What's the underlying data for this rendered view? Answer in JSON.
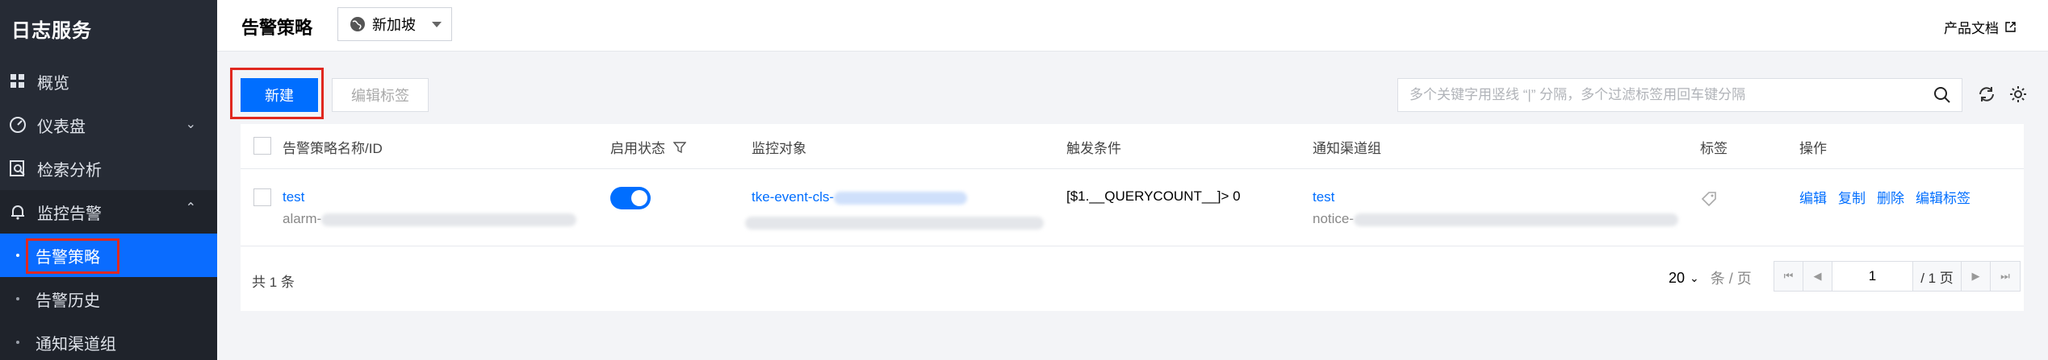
{
  "sidebar": {
    "brand": "日志服务",
    "items": [
      {
        "label": "概览",
        "icon": "grid-icon"
      },
      {
        "label": "仪表盘",
        "icon": "dashboard-icon"
      },
      {
        "label": "检索分析",
        "icon": "search-doc-icon"
      },
      {
        "label": "监控告警",
        "icon": "bell-icon"
      }
    ],
    "subitems": [
      {
        "label": "告警策略",
        "active": true
      },
      {
        "label": "告警历史"
      },
      {
        "label": "通知渠道组"
      }
    ]
  },
  "header": {
    "title": "告警策略",
    "region": "新加坡",
    "doc_link": "产品文档"
  },
  "toolbar": {
    "new_label": "新建",
    "edit_tags_label": "编辑标签",
    "search_placeholder": "多个关键字用竖线 “|” 分隔，多个过滤标签用回车键分隔"
  },
  "table": {
    "columns": [
      "告警策略名称/ID",
      "启用状态",
      "监控对象",
      "触发条件",
      "通知渠道组",
      "标签",
      "操作"
    ],
    "rows": [
      {
        "name": "test",
        "id": "alarm-",
        "enabled": true,
        "monitor_object": "tke-event-cls-",
        "trigger": "[$1.__QUERYCOUNT__]> 0",
        "notice_group": "test",
        "notice_id": "notice-",
        "actions": [
          "编辑",
          "复制",
          "删除",
          "编辑标签"
        ]
      }
    ],
    "total": "共 1 条",
    "page_size": "20",
    "page_size_unit": "条 / 页",
    "current_page": "1",
    "total_pages": "/ 1 页"
  },
  "colors": {
    "accent": "#006eff",
    "sidebar_bg": "#262b35",
    "highlight_box": "#e0281f"
  }
}
